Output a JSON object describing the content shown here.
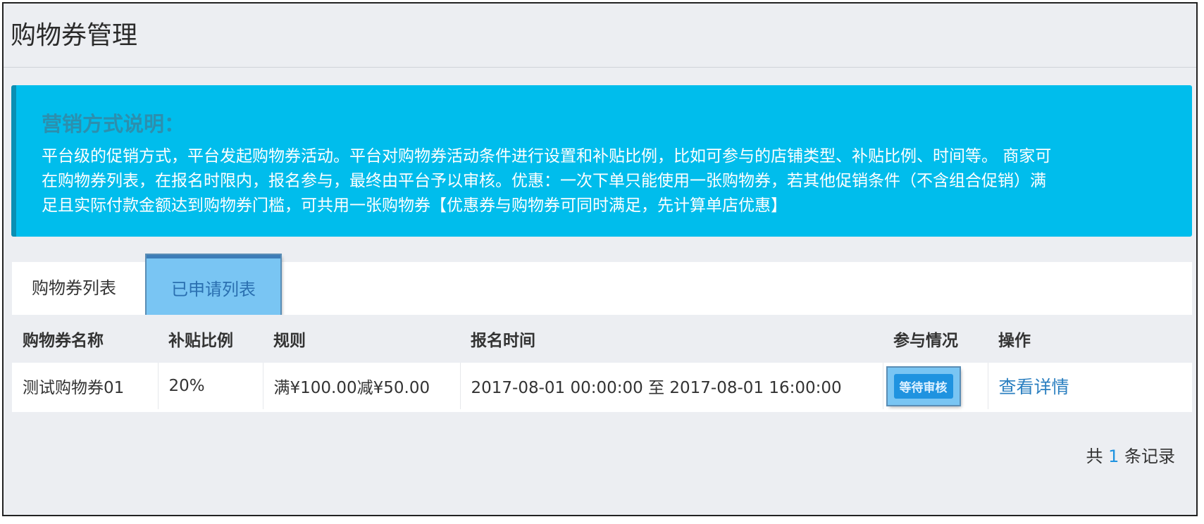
{
  "header": {
    "title": "购物券管理"
  },
  "notice": {
    "title": "营销方式说明：",
    "lines": [
      "平台级的促销方式，平台发起购物券活动。平台对购物券活动条件进行设置和补贴比例，比如可参与的店铺类型、补贴比例、时间等。 商家可",
      "在购物券列表，在报名时限内，报名参与，最终由平台予以审核。优惠：一次下单只能使用一张购物券，若其他促销条件（不含组合促销）满",
      "足且实际付款金额达到购物券门槛，可共用一张购物券【优惠券与购物券可同时满足，先计算单店优惠】"
    ]
  },
  "tabs": [
    {
      "label": "购物券列表",
      "active": false
    },
    {
      "label": "已申请列表",
      "active": true
    }
  ],
  "table": {
    "columns": [
      "购物券名称",
      "补贴比例",
      "规则",
      "报名时间",
      "参与情况",
      "操作"
    ],
    "rows": [
      {
        "name": "测试购物券01",
        "ratio": "20%",
        "rule": "满¥100.00减¥50.00",
        "time": "2017-08-01 00:00:00 至 2017-08-01 16:00:00",
        "status": "等待审核",
        "action": "查看详情"
      }
    ]
  },
  "footer": {
    "prefix": "共",
    "count": "1",
    "suffix": "条记录"
  },
  "colors": {
    "notice_bg": "#00bdec",
    "status_badge": "#1f93e0",
    "ratio_text": "#1fa33c",
    "link": "#2b7fc0"
  }
}
